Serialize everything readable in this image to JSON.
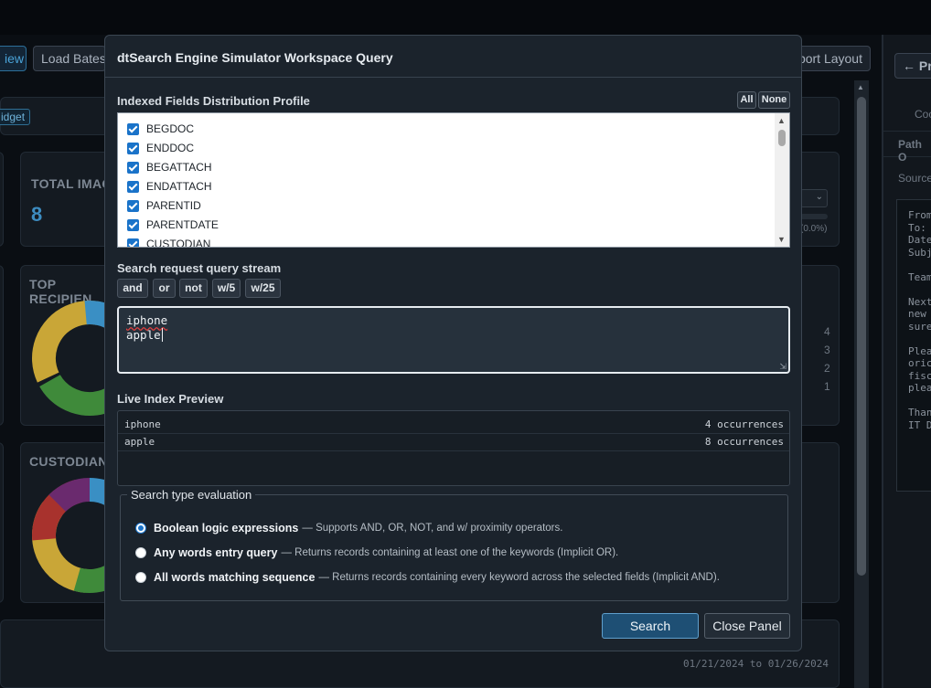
{
  "background": {
    "toolbar": {
      "view_label": "iew",
      "load_bates_label": "Load Bates",
      "export_layout_label": "port Layout",
      "back_label": "← Pr"
    },
    "badge_label": "idget",
    "total_images": {
      "label": "TOTAL IMAG",
      "value": "8"
    },
    "top_recipients_label": "TOP RECIPIEN",
    "custodians_label": "CUSTODIANS",
    "bar_percent": "(0.0%)",
    "axis_ticks": [
      "4",
      "3",
      "2",
      "1"
    ],
    "date_range": "01/21/2024 to 01/26/2024",
    "right_tabs": {
      "tab1": "Coc",
      "tab2": "Path O",
      "source_label": "Source"
    },
    "email_preview": [
      "From",
      "To: ",
      "Date",
      "Subj",
      "",
      "Team",
      "",
      "Next",
      "new ",
      "sure",
      "",
      "Plea",
      "oric",
      "fisc",
      "plea",
      "",
      "Than",
      "IT D"
    ]
  },
  "modal": {
    "title": "dtSearch Engine Simulator Workspace Query",
    "fields_label": "Indexed Fields Distribution Profile",
    "all_label": "All",
    "none_label": "None",
    "fields": [
      {
        "name": "BEGDOC",
        "checked": true
      },
      {
        "name": "ENDDOC",
        "checked": true
      },
      {
        "name": "BEGATTACH",
        "checked": true
      },
      {
        "name": "ENDATTACH",
        "checked": true
      },
      {
        "name": "PARENTID",
        "checked": true
      },
      {
        "name": "PARENTDATE",
        "checked": true
      },
      {
        "name": "CUSTODIAN",
        "checked": true
      }
    ],
    "query_label": "Search request query stream",
    "operators": [
      "and",
      "or",
      "not",
      "w/5",
      "w/25"
    ],
    "query_lines": [
      "iphone",
      "apple"
    ],
    "preview_label": "Live Index Preview",
    "preview_rows": [
      {
        "term": "iphone",
        "count": "4 occurrences"
      },
      {
        "term": "apple",
        "count": "8 occurrences"
      }
    ],
    "search_type_label": "Search type evaluation",
    "search_types": [
      {
        "title": "Boolean logic expressions",
        "desc": "— Supports AND, OR, NOT, and w/ proximity operators.",
        "selected": true
      },
      {
        "title": "Any words entry query",
        "desc": "— Returns records containing at least one of the keywords (Implicit OR).",
        "selected": false
      },
      {
        "title": "All words matching sequence",
        "desc": "— Returns records containing every keyword across the selected fields (Implicit AND).",
        "selected": false
      }
    ],
    "search_button": "Search",
    "close_button": "Close Panel"
  },
  "colors": {
    "accent": "#1a73c9",
    "primary_button": "#1e4f74",
    "donut_top": [
      "#3a8fc4",
      "#3f8a3a",
      "#c9a637"
    ],
    "donut_custodians": [
      "#3a8fc4",
      "#3f8a3a",
      "#c9a637",
      "#a8322d",
      "#6a2a6e"
    ]
  }
}
